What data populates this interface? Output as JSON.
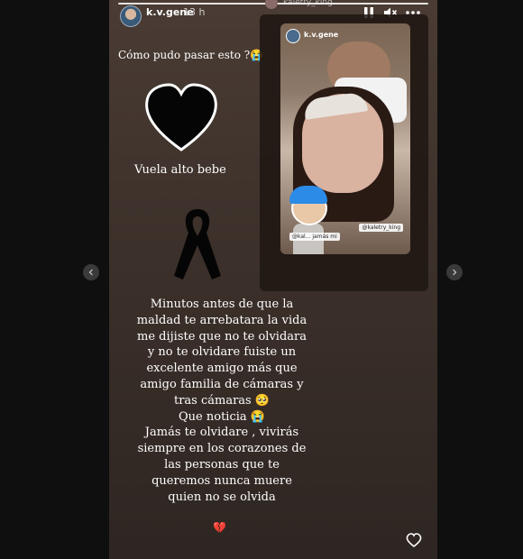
{
  "header": {
    "username": "k.v.gene",
    "time": "13 h",
    "tagged_username": "kaletry_king"
  },
  "controls": {
    "pause_icon": "pause-icon",
    "mute_icon": "speaker-muted-icon",
    "more_icon": "more-icon"
  },
  "story": {
    "line1": "Cómo pudo pasar esto ?😭",
    "caption": "Vuela alto bebe",
    "message_lines": [
      "Minutos antes de que la",
      "maldad te arrebatara la vida",
      "me dijiste que no te olvidara",
      "y no te olvidare fuiste un",
      "excelente amigo más que",
      "amigo familia de cámaras y",
      "tras cámaras 🥺",
      "Que noticia 😭",
      "Jamás te olvidare , vivirás",
      "siempre en los corazones de",
      "las personas que te",
      "queremos nunca muere",
      "quien no se olvida"
    ],
    "broken_heart": "💔"
  },
  "repost": {
    "username": "k.v.gene",
    "sticker_text": "@kal... jamás mi",
    "tag": "@kaletry_king"
  },
  "colors": {
    "background": "#0f0f0f",
    "story_bg": "#4a3c34",
    "text": "#ffffff"
  }
}
